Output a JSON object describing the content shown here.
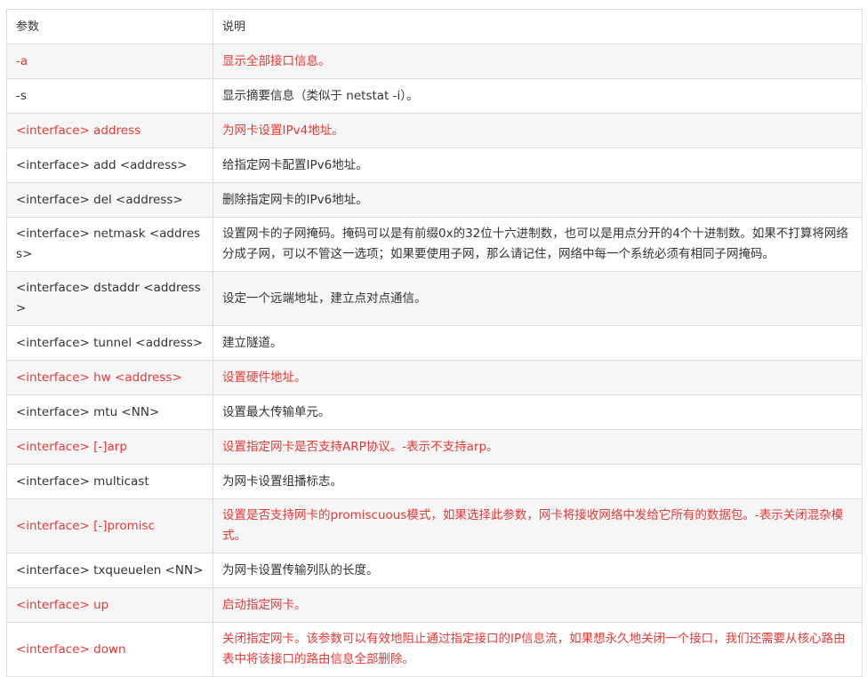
{
  "table": {
    "headers": [
      "参数",
      "说明"
    ],
    "rows": [
      {
        "param": "-a",
        "desc": "显示全部接口信息。",
        "highlight": true
      },
      {
        "param": "-s",
        "desc": "显示摘要信息（类似于 netstat -i）。",
        "highlight": false
      },
      {
        "param": "<interface> address",
        "desc": "为网卡设置IPv4地址。",
        "highlight": true
      },
      {
        "param": "<interface> add <address>",
        "desc": "给指定网卡配置IPv6地址。",
        "highlight": false
      },
      {
        "param": "<interface> del <address>",
        "desc": "删除指定网卡的IPv6地址。",
        "highlight": false
      },
      {
        "param": "<interface> netmask <address>",
        "desc": "设置网卡的子网掩码。掩码可以是有前缀0x的32位十六进制数，也可以是用点分开的4个十进制数。如果不打算将网络分成子网，可以不管这一选项；如果要使用子网，那么请记住，网络中每一个系统必须有相同子网掩码。",
        "highlight": false
      },
      {
        "param": "<interface> dstaddr <address>",
        "desc": "设定一个远端地址，建立点对点通信。",
        "highlight": false
      },
      {
        "param": "<interface> tunnel <address>",
        "desc": "建立隧道。",
        "highlight": false
      },
      {
        "param": "<interface> hw <address>",
        "desc": "设置硬件地址。",
        "highlight": true
      },
      {
        "param": "<interface> mtu <NN>",
        "desc": "设置最大传输单元。",
        "highlight": false
      },
      {
        "param": "<interface> [-]arp",
        "desc": "设置指定网卡是否支持ARP协议。-表示不支持arp。",
        "highlight": true
      },
      {
        "param": "<interface> multicast",
        "desc": "为网卡设置组播标志。",
        "highlight": false
      },
      {
        "param": "<interface> [-]promisc",
        "desc": "设置是否支持网卡的promiscuous模式，如果选择此参数，网卡将接收网络中发给它所有的数据包。-表示关闭混杂模式。",
        "highlight": true
      },
      {
        "param": "<interface> txqueuelen <NN>",
        "desc": "为网卡设置传输列队的长度。",
        "highlight": false
      },
      {
        "param": "<interface> up",
        "desc": "启动指定网卡。",
        "highlight": true
      },
      {
        "param": "<interface> down",
        "desc": "关闭指定网卡。该参数可以有效地阻止通过指定接口的IP信息流，如果想永久地关闭一个接口，我们还需要从核心路由表中将该接口的路由信息全部删除。",
        "highlight": true
      }
    ]
  },
  "colors": {
    "highlight_text": "#e53935",
    "normal_text": "#333333",
    "alt_row_bg": "#f6f6f6",
    "border": "#dedede"
  }
}
